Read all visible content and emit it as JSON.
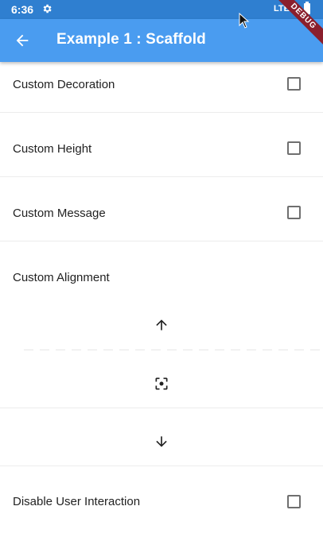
{
  "status_bar": {
    "time": "6:36",
    "network": "LTE",
    "settings_icon": "gear-icon",
    "battery_icon": "battery-icon"
  },
  "app_bar": {
    "title": "Example 1 : Scaffold",
    "back_icon": "arrow-back-icon",
    "color": "#4a9cf0"
  },
  "debug_banner": "DEBUG",
  "list": {
    "items": [
      {
        "label": "Custom Decoration",
        "checked": false
      },
      {
        "label": "Custom Height",
        "checked": false
      },
      {
        "label": "Custom Message",
        "checked": false
      },
      {
        "label": "Custom Alignment"
      },
      {
        "label": "Disable User Interaction",
        "checked": false
      }
    ],
    "alignment_controls": {
      "top_icon": "arrow-up-icon",
      "center_icon": "center-focus-icon",
      "bottom_icon": "arrow-down-icon"
    }
  }
}
